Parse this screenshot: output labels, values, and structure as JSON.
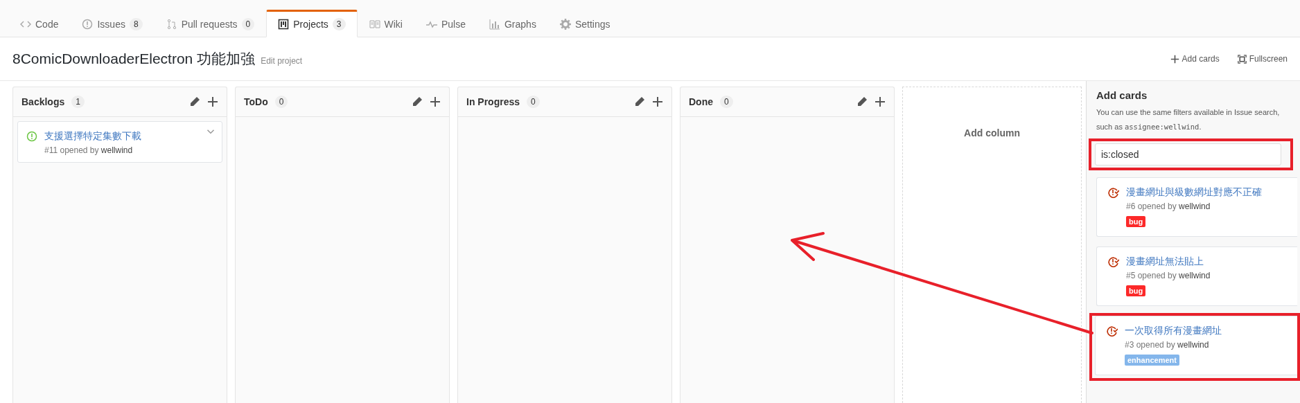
{
  "tabs": [
    {
      "label": "Code",
      "selected": false
    },
    {
      "label": "Issues",
      "count": "8",
      "selected": false
    },
    {
      "label": "Pull requests",
      "count": "0",
      "selected": false
    },
    {
      "label": "Projects",
      "count": "3",
      "selected": true
    },
    {
      "label": "Wiki",
      "selected": false
    },
    {
      "label": "Pulse",
      "selected": false
    },
    {
      "label": "Graphs",
      "selected": false
    },
    {
      "label": "Settings",
      "selected": false
    }
  ],
  "project": {
    "title": "8ComicDownloaderElectron 功能加強",
    "edit_link": "Edit project",
    "actions": [
      {
        "label": "Add cards"
      },
      {
        "label": "Fullscreen"
      }
    ]
  },
  "columns": [
    {
      "name": "Backlogs",
      "count": "1",
      "cards": [
        {
          "title": "支援選擇特定集數下載",
          "meta": "#11 opened by ",
          "author": "wellwind",
          "closed": false
        }
      ]
    },
    {
      "name": "ToDo",
      "count": "0"
    },
    {
      "name": "In Progress",
      "count": "0"
    },
    {
      "name": "Done",
      "count": "0"
    }
  ],
  "add_column": "Add column",
  "add_cards_panel": {
    "title": "Add cards",
    "help": "You can use the same filters available in Issue search, such as ",
    "help_code": "assignee:wellwind",
    "help_end": ".",
    "search": {
      "value": "is:closed",
      "highlighted": true
    },
    "results": [
      {
        "title": "漫畫網址與級數網址對應不正確",
        "meta": "#6 opened by ",
        "author": "wellwind",
        "closed": true,
        "labels": [
          {
            "name": "bug",
            "color": "#fc2929"
          }
        ],
        "highlighted": false
      },
      {
        "title": "漫畫網址無法貼上",
        "meta": "#5 opened by ",
        "author": "wellwind",
        "closed": true,
        "labels": [
          {
            "name": "bug",
            "color": "#fc2929"
          }
        ],
        "highlighted": false
      },
      {
        "title": "一次取得所有漫畫網址",
        "meta": "#3 opened by ",
        "author": "wellwind",
        "closed": true,
        "labels": [
          {
            "name": "enhancement",
            "color": "#84b6eb"
          }
        ],
        "highlighted": true
      }
    ]
  },
  "annotation_arrow": true
}
